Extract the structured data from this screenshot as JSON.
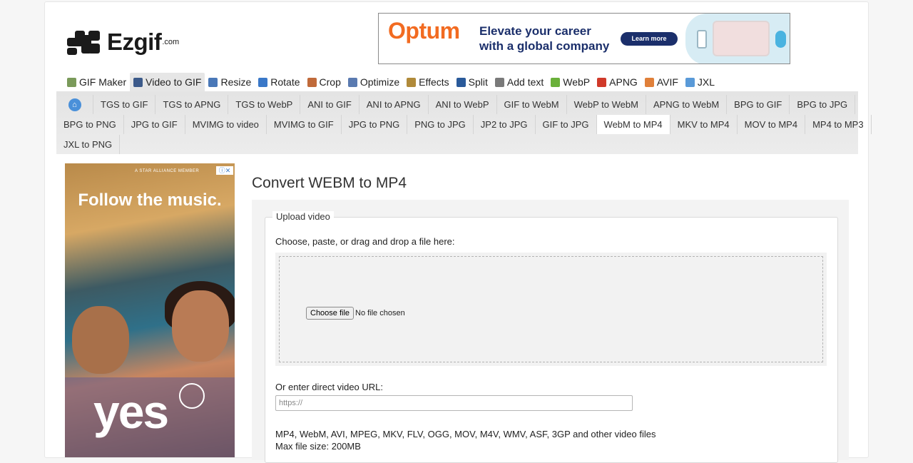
{
  "logo": {
    "name": "Ezgif",
    "tld": ".com"
  },
  "top_ad": {
    "brand": "Optum",
    "tagline_line1": "Elevate your career",
    "tagline_line2": "with a global company",
    "cta": "Learn more"
  },
  "main_tabs": [
    {
      "label": "GIF Maker",
      "icon": "gif-maker-icon",
      "color": "#7a9a5a",
      "active": false
    },
    {
      "label": "Video to GIF",
      "icon": "video-to-gif-icon",
      "color": "#3c5a8a",
      "active": true
    },
    {
      "label": "Resize",
      "icon": "resize-icon",
      "color": "#4a78b8",
      "active": false
    },
    {
      "label": "Rotate",
      "icon": "rotate-icon",
      "color": "#3a78c8",
      "active": false
    },
    {
      "label": "Crop",
      "icon": "crop-icon",
      "color": "#c06a3a",
      "active": false
    },
    {
      "label": "Optimize",
      "icon": "optimize-icon",
      "color": "#5a7ab0",
      "active": false
    },
    {
      "label": "Effects",
      "icon": "effects-icon",
      "color": "#b08a3a",
      "active": false
    },
    {
      "label": "Split",
      "icon": "split-icon",
      "color": "#2a5a9a",
      "active": false
    },
    {
      "label": "Add text",
      "icon": "add-text-icon",
      "color": "#7a7a7a",
      "active": false
    },
    {
      "label": "WebP",
      "icon": "webp-icon",
      "color": "#6ab03a",
      "active": false
    },
    {
      "label": "APNG",
      "icon": "apng-icon",
      "color": "#d03a2a",
      "active": false
    },
    {
      "label": "AVIF",
      "icon": "avif-icon",
      "color": "#e0803a",
      "active": false
    },
    {
      "label": "JXL",
      "icon": "jxl-icon",
      "color": "#5a9ad8",
      "active": false
    }
  ],
  "sub_tabs_row1": [
    "TGS to GIF",
    "TGS to APNG",
    "TGS to WebP",
    "ANI to GIF",
    "ANI to APNG",
    "ANI to WebP",
    "GIF to WebM",
    "WebP to WebM",
    "APNG to WebM",
    "BPG to GIF",
    "BPG to JPG"
  ],
  "sub_tabs_row2": [
    "BPG to PNG",
    "JPG to GIF",
    "MVIMG to video",
    "MVIMG to GIF",
    "JPG to PNG",
    "PNG to JPG",
    "JP2 to JPG",
    "GIF to JPG",
    "WebM to MP4",
    "MKV to MP4",
    "MOV to MP4",
    "MP4 to MP3"
  ],
  "sub_tabs_row3": [
    "JXL to PNG"
  ],
  "active_sub_tab": "WebM to MP4",
  "side_ad": {
    "top_text": "A STAR ALLIANCE MEMBER",
    "headline": "Follow the music.",
    "word": "yes"
  },
  "page": {
    "title": "Convert WEBM to MP4",
    "legend": "Upload video",
    "choose_label": "Choose, paste, or drag and drop a file here:",
    "file_button": "Choose file",
    "file_status": "No file chosen",
    "url_label": "Or enter direct video URL:",
    "url_placeholder": "https://",
    "formats": "MP4, WebM, AVI, MPEG, MKV, FLV, OGG, MOV, M4V, WMV, ASF, 3GP and other video files",
    "max_size": "Max file size: 200MB"
  }
}
